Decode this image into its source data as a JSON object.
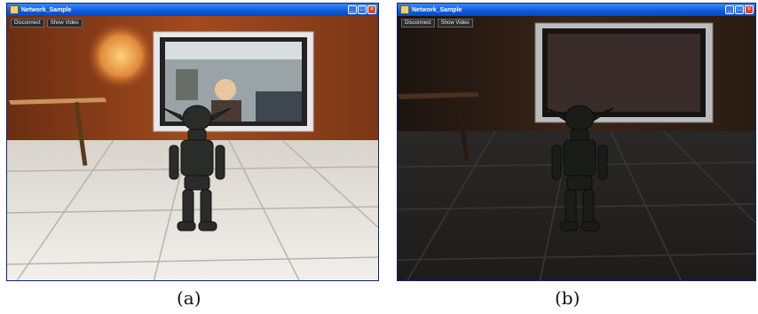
{
  "windows": [
    {
      "title": "Network_Sample",
      "buttons": [
        "Disconnect",
        "Show Video"
      ],
      "caption": "(a)"
    },
    {
      "title": "Network_Sample",
      "buttons": [
        "Disconnect",
        "Show Video"
      ],
      "caption": "(b)"
    }
  ],
  "colors": {
    "titlebar": "#0a5adf",
    "close_button": "#d9472a"
  }
}
